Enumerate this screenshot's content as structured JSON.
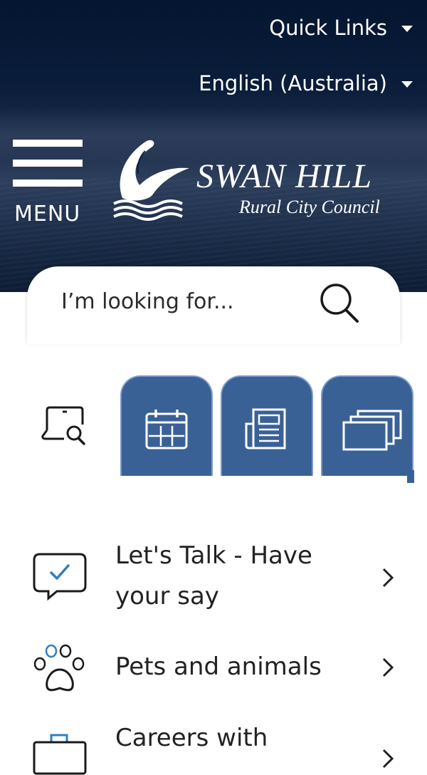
{
  "header": {
    "quick_links": "Quick Links",
    "language": "English (Australia)",
    "menu_label": "MENU",
    "logo_title": "SWAN HILL",
    "logo_subtitle": "Rural City Council"
  },
  "search": {
    "placeholder": "I’m looking for..."
  },
  "tabs": [
    {
      "icon": "laptop-search-icon",
      "active": true
    },
    {
      "icon": "calendar-icon"
    },
    {
      "icon": "newspaper-icon"
    },
    {
      "icon": "stacked-windows-icon"
    }
  ],
  "quick_items": [
    {
      "label": "Let's Talk - Have your say",
      "icon": "chat-check-icon"
    },
    {
      "label": "Pets and animals",
      "icon": "paw-icon"
    },
    {
      "label": "Careers with",
      "icon": "briefcase-icon"
    }
  ],
  "colors": {
    "tab_blue": "#3a6195",
    "tab_border": "#7c9acb",
    "hero_dark": "#0a1d3a",
    "check_blue": "#2f7fc0"
  }
}
